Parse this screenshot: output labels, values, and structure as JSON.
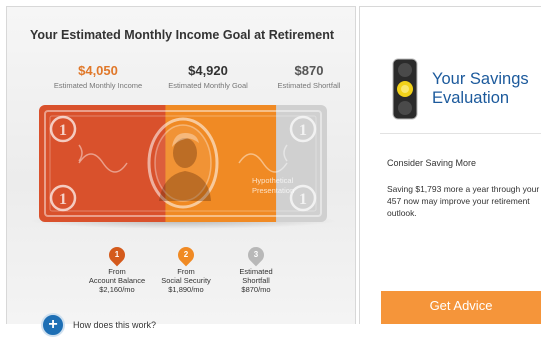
{
  "goal_panel": {
    "title": "Your Estimated Monthly Income Goal at Retirement",
    "stats": [
      {
        "value": "$4,050",
        "label": "Estimated Monthly Income",
        "color": "#e0782a"
      },
      {
        "value": "$4,920",
        "label": "Estimated Monthly Goal",
        "color": "#333333"
      },
      {
        "value": "$870",
        "label": "Estimated Shortfall",
        "color": "#555555"
      }
    ],
    "bill": {
      "watermark_line1": "Hypothetical",
      "watermark_line2": "Presentation",
      "segments": [
        {
          "source": "Account Balance",
          "amount_per_month": 2160,
          "color": "#d9512c"
        },
        {
          "source": "Social Security",
          "amount_per_month": 1890,
          "color": "#f08a24"
        },
        {
          "source": "Estimated Shortfall",
          "amount_per_month": 870,
          "color": "#d0d0d0"
        }
      ]
    },
    "markers": [
      {
        "num": "1",
        "line1": "From",
        "line2": "Account Balance",
        "line3": "$2,160/mo",
        "color": "#d45a1c"
      },
      {
        "num": "2",
        "line1": "From",
        "line2": "Social Security",
        "line3": "$1,890/mo",
        "color": "#f08a24"
      },
      {
        "num": "3",
        "line1": "Estimated",
        "line2": "Shortfall",
        "line3": "$870/mo",
        "color": "#b8b8b8"
      }
    ],
    "how_link": "How does this work?",
    "how_icon": "plus-icon"
  },
  "evaluation_panel": {
    "icon": "traffic-light-icon",
    "status": "yellow",
    "title_line1": "Your Savings",
    "title_line2": "Evaluation",
    "subhead": "Consider Saving More",
    "body": "Saving $1,793 more a year through your 457 now may improve your retirement outlook.",
    "button_label": "Get Advice",
    "accent": "#f5953a",
    "title_color": "#1c5a9c"
  }
}
